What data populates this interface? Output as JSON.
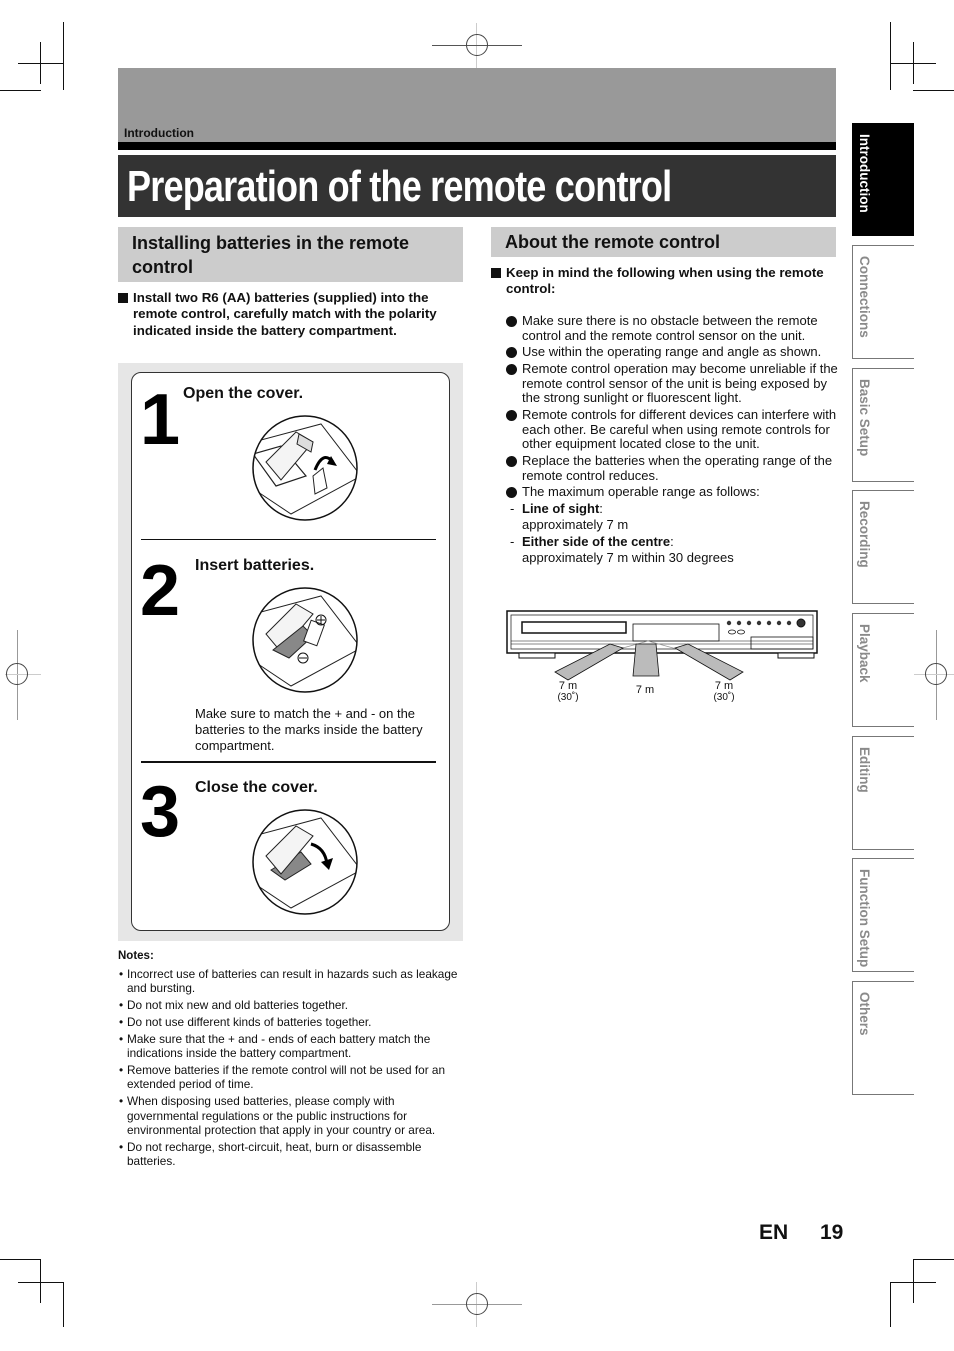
{
  "header": {
    "section_label": "Introduction",
    "title": "Preparation of the remote control"
  },
  "left": {
    "heading": "Installing batteries in the remote control",
    "lead": "Install two R6 (AA) batteries (supplied) into the remote control, carefully match with the polarity indicated inside the battery compartment.",
    "steps": [
      {
        "number": "1",
        "title": "Open the cover.",
        "illustration": "remote-open-cover-illustration"
      },
      {
        "number": "2",
        "title": "Insert batteries.",
        "note": "Make sure to match the + and - on the batteries to the marks inside the battery compartment.",
        "illustration": "remote-insert-batteries-illustration"
      },
      {
        "number": "3",
        "title": "Close the cover.",
        "illustration": "remote-close-cover-illustration"
      }
    ],
    "notes_title": "Notes:",
    "notes": [
      "Incorrect use of batteries can result in hazards such as leakage and bursting.",
      "Do not mix new and old batteries together.",
      "Do not use different kinds of batteries together.",
      "Make sure that the + and - ends of each battery match the indications inside the battery compartment.",
      "Remove batteries if the remote control will not be used for an extended period of time.",
      "When disposing used batteries, please comply with governmental regulations or the public instructions for environmental protection that apply in your country or area.",
      "Do not recharge, short-circuit, heat, burn or disassemble batteries."
    ]
  },
  "right": {
    "heading": "About the remote control",
    "lead": "Keep in mind the following when using the remote control:",
    "bullets": [
      "Make sure there is no obstacle between the remote control and the remote control sensor on the unit.",
      "Use within the operating range and angle as shown.",
      "Remote control operation may become unreliable if the remote control sensor of the unit is being exposed by the strong sunlight or fluorescent light.",
      "Remote controls for different devices can interfere with each other. Be careful when using remote controls for other equipment located close to the unit.",
      "Replace the batteries when the operating range of the remote control reduces.",
      "The maximum operable range as follows:"
    ],
    "ranges": [
      {
        "label": "Line of sight",
        "value": "approximately 7 m"
      },
      {
        "label": "Either side of the centre",
        "value": "approximately 7 m within 30 degrees"
      }
    ],
    "diagram": {
      "left_distance": "7 m",
      "left_angle": "(30˚)",
      "center_distance": "7 m",
      "right_distance": "7 m",
      "right_angle": "(30˚)"
    }
  },
  "side_tabs": [
    {
      "label": "Introduction",
      "active": true
    },
    {
      "label": "Connections",
      "active": false
    },
    {
      "label": "Basic Setup",
      "active": false
    },
    {
      "label": "Recording",
      "active": false
    },
    {
      "label": "Playback",
      "active": false
    },
    {
      "label": "Editing",
      "active": false
    },
    {
      "label": "Function Setup",
      "active": false
    },
    {
      "label": "Others",
      "active": false
    }
  ],
  "footer": {
    "language": "EN",
    "page_number": "19"
  }
}
